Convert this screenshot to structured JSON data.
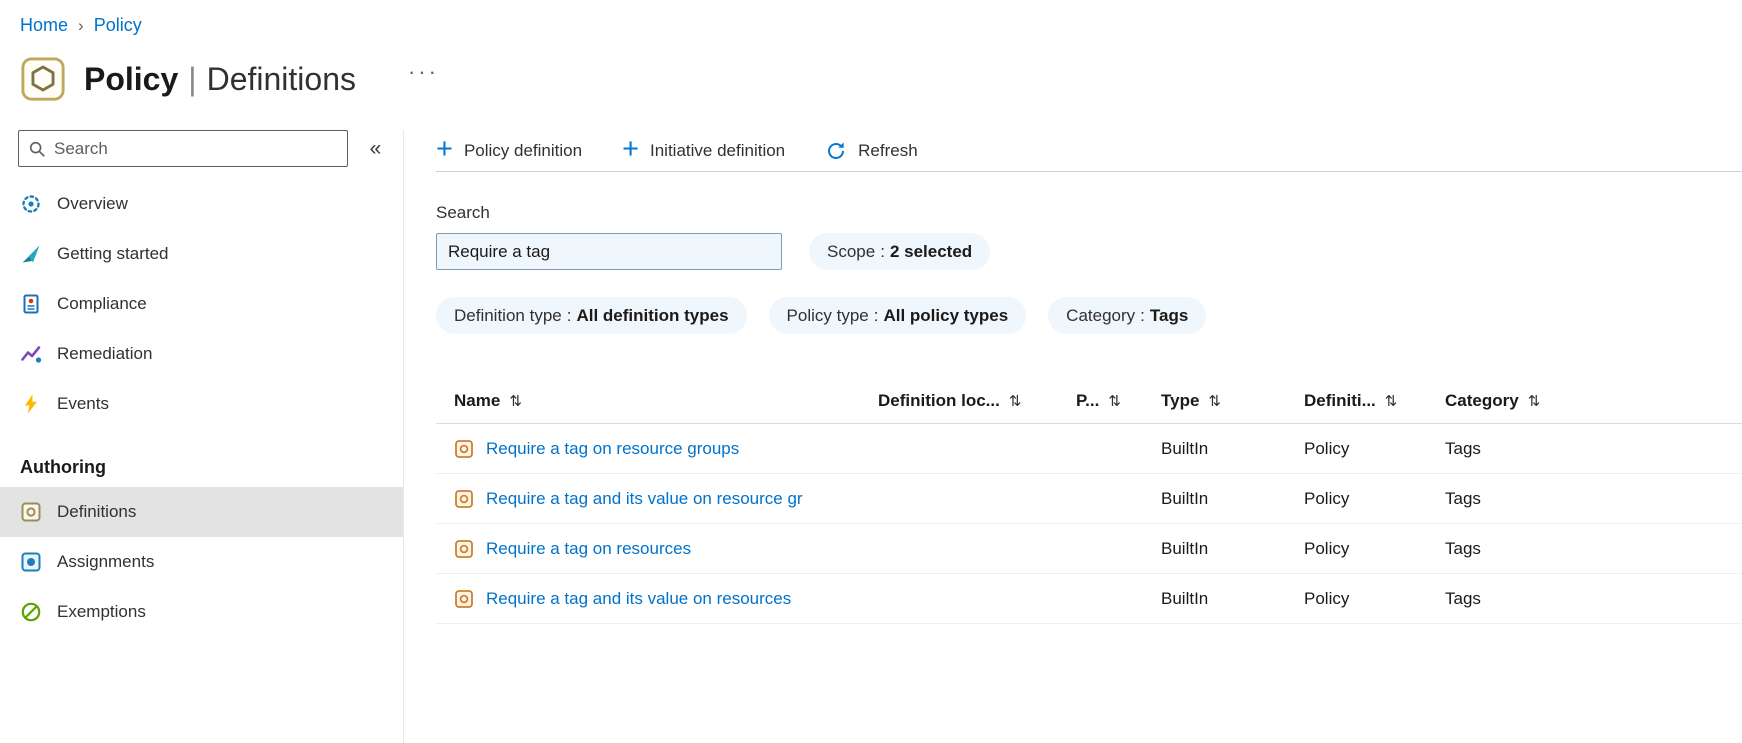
{
  "colors": {
    "accent": "#0078d4",
    "link": "#0072c9",
    "pill_bg": "#eff6fc",
    "selected_item_bg": "#e3e3e3",
    "events_yellow": "#ffb900",
    "exemptions_green": "#5ca300"
  },
  "breadcrumb": {
    "separator": "›",
    "items": [
      {
        "label": "Home"
      },
      {
        "label": "Policy"
      }
    ]
  },
  "header": {
    "title_primary": "Policy",
    "title_divider": "|",
    "title_secondary": "Definitions",
    "more_icon": "···"
  },
  "sidebar": {
    "search": {
      "placeholder": "Search"
    },
    "collapse_icon": "«",
    "items": [
      {
        "label": "Overview"
      },
      {
        "label": "Getting started"
      },
      {
        "label": "Compliance"
      },
      {
        "label": "Remediation"
      },
      {
        "label": "Events"
      }
    ],
    "section": {
      "label": "Authoring",
      "items": [
        {
          "label": "Definitions",
          "selected": true
        },
        {
          "label": "Assignments",
          "selected": false
        },
        {
          "label": "Exemptions",
          "selected": false
        }
      ]
    }
  },
  "toolbar": {
    "plus_icon": "+",
    "items": [
      {
        "label": "Policy definition"
      },
      {
        "label": "Initiative definition"
      },
      {
        "label": "Refresh"
      }
    ]
  },
  "filters": {
    "search_label": "Search",
    "search_value": "Require a tag",
    "pill_separator": ":",
    "pills": [
      {
        "name": "Scope",
        "value": "2 selected"
      },
      {
        "name": "Definition type",
        "value": "All definition types"
      },
      {
        "name": "Policy type",
        "value": "All policy types"
      },
      {
        "name": "Category",
        "value": "Tags"
      }
    ]
  },
  "table": {
    "sort_icon": "⇅",
    "columns": [
      {
        "label": "Name"
      },
      {
        "label": "Definition loc..."
      },
      {
        "label": "P..."
      },
      {
        "label": "Type"
      },
      {
        "label": "Definiti..."
      },
      {
        "label": "Category"
      }
    ],
    "rows": [
      {
        "name": "Require a tag on resource groups",
        "definition_location": "",
        "p": "",
        "type": "BuiltIn",
        "definition_type": "Policy",
        "category": "Tags"
      },
      {
        "name": "Require a tag and its value on resource gr",
        "definition_location": "",
        "p": "",
        "type": "BuiltIn",
        "definition_type": "Policy",
        "category": "Tags"
      },
      {
        "name": "Require a tag on resources",
        "definition_location": "",
        "p": "",
        "type": "BuiltIn",
        "definition_type": "Policy",
        "category": "Tags"
      },
      {
        "name": "Require a tag and its value on resources",
        "definition_location": "",
        "p": "",
        "type": "BuiltIn",
        "definition_type": "Policy",
        "category": "Tags"
      }
    ]
  }
}
